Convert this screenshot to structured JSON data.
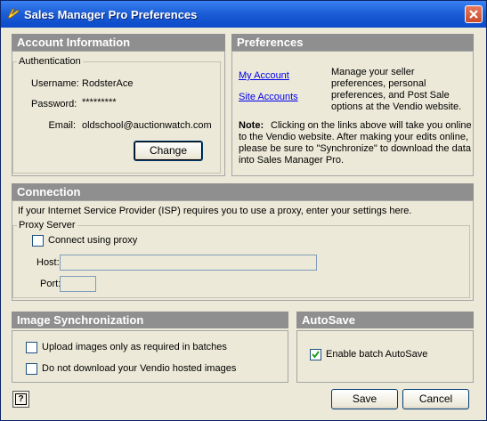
{
  "window": {
    "title": "Sales Manager Pro Preferences"
  },
  "account": {
    "header": "Account Information",
    "group_label": "Authentication",
    "username_label": "Username:",
    "username_value": "RodsterAce",
    "password_label": "Password:",
    "password_value": "*********",
    "email_label": "Email:",
    "email_value": "oldschool@auctionwatch.com",
    "change_button": "Change"
  },
  "preferences": {
    "header": "Preferences",
    "my_account_link": "My Account",
    "site_accounts_link": "Site Accounts",
    "description": "Manage your seller preferences, personal preferences, and Post Sale options at the Vendio website.",
    "note_label": "Note:",
    "note_text": "Clicking on the links above will take you online to the Vendio website. After making your edits online, please be sure to \"Synchronize\" to download the data into Sales Manager Pro."
  },
  "connection": {
    "header": "Connection",
    "intro": "If your Internet Service Provider (ISP) requires you to use a proxy, enter your settings here.",
    "proxy_group": "Proxy Server",
    "connect_proxy_label": "Connect using proxy",
    "connect_proxy_checked": false,
    "host_label": "Host:",
    "host_value": "",
    "port_label": "Port:",
    "port_value": ""
  },
  "image_sync": {
    "header": "Image Synchronization",
    "upload_label": "Upload images only as required in batches",
    "upload_checked": false,
    "nodownload_label": "Do not download your Vendio hosted images",
    "nodownload_checked": false
  },
  "autosave": {
    "header": "AutoSave",
    "enable_label": "Enable batch AutoSave",
    "enable_checked": true
  },
  "footer": {
    "help_icon_text": "?",
    "save_button": "Save",
    "cancel_button": "Cancel"
  }
}
